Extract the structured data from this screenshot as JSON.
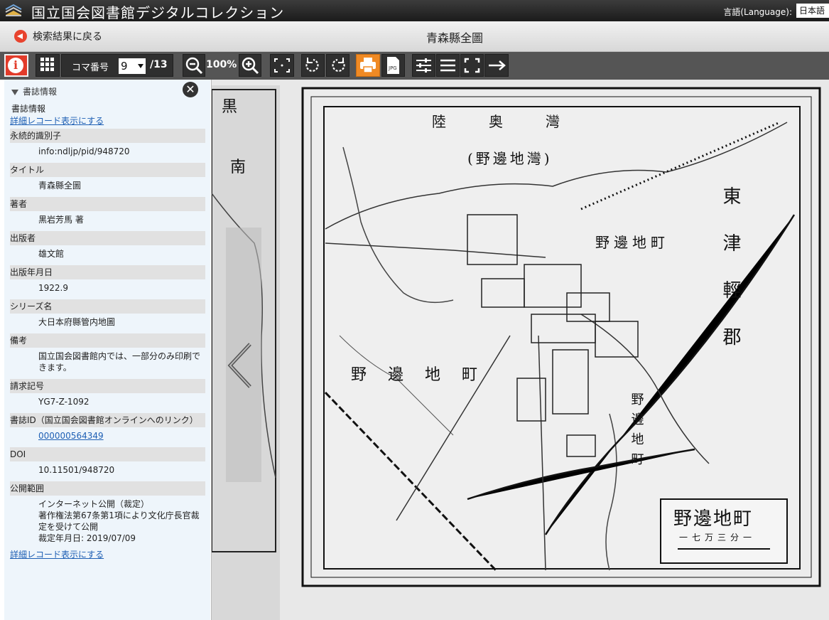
{
  "header": {
    "app_title": "国立国会図書館デジタルコレクション",
    "language_label": "言語(Language):",
    "language_value": "日本語"
  },
  "subheader": {
    "back_label": "検索結果に戻る",
    "doc_title": "青森縣全圖"
  },
  "toolbar": {
    "koma_label": "コマ番号",
    "koma_value": "9",
    "koma_total": "/13",
    "zoom": "100%"
  },
  "sidebar": {
    "panel_title": "書誌情報",
    "section_heading": "書誌情報",
    "detail_link": "詳細レコード表示にする",
    "fields": [
      {
        "label": "永続的識別子",
        "value": "info:ndljp/pid/948720"
      },
      {
        "label": "タイトル",
        "value": "青森縣全圖"
      },
      {
        "label": "著者",
        "value": "黒岩芳馬 著"
      },
      {
        "label": "出版者",
        "value": "雄文館"
      },
      {
        "label": "出版年月日",
        "value": "1922.9"
      },
      {
        "label": "シリーズ名",
        "value": "大日本府縣管内地圖"
      },
      {
        "label": "備考",
        "value": "国立国会図書館内では、一部分のみ印刷できます。"
      },
      {
        "label": "請求記号",
        "value": "YG7-Z-1092"
      },
      {
        "label": "書誌ID（国立国会図書館オンラインへのリンク）",
        "value": "000000564349",
        "link": true
      },
      {
        "label": "DOI",
        "value": "10.11501/948720"
      },
      {
        "label": "公開範囲",
        "value": "インターネット公開（裁定）",
        "extra": [
          "著作権法第67条第1項により文化庁長官裁定を受けて公開",
          "裁定年月日: 2019/07/09"
        ]
      }
    ],
    "detail_link_bottom": "詳細レコード表示にする"
  },
  "map": {
    "title_top": "陸奥灣",
    "subtitle_top": "(野邊地灣)",
    "town_left": "野邊地町",
    "town_center": "野邊地町",
    "town_right": "野邊地町",
    "district": "東津輕郡",
    "edge_left_1": "黒",
    "edge_left_2": "南",
    "legend_title": "野邊地町",
    "legend_scale": "一七万三分一"
  }
}
